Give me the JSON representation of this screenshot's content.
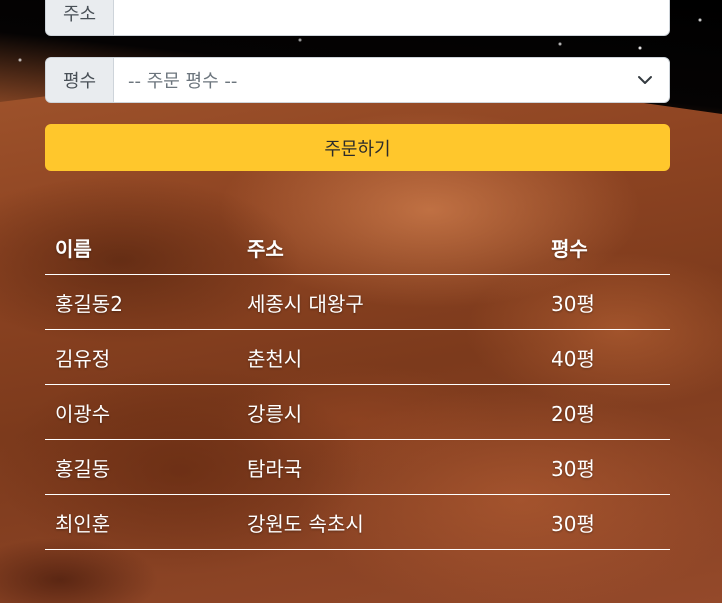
{
  "form": {
    "address_label": "주소",
    "address_value": "",
    "pyeong_label": "평수",
    "pyeong_selected": "-- 주문 평수 --",
    "order_button": "주문하기"
  },
  "table": {
    "headers": [
      "이름",
      "주소",
      "평수"
    ],
    "rows": [
      [
        "홍길동2",
        "세종시 대왕구",
        "30평"
      ],
      [
        "김유정",
        "춘천시",
        "40평"
      ],
      [
        "이광수",
        "강릉시",
        "20평"
      ],
      [
        "홍길동",
        "탐라국",
        "30평"
      ],
      [
        "최인훈",
        "강원도 속초시",
        "30평"
      ]
    ]
  },
  "colors": {
    "button": "#ffc72c",
    "label_bg": "#e9ecef"
  },
  "icons": {
    "select": "chevron-down-icon"
  }
}
